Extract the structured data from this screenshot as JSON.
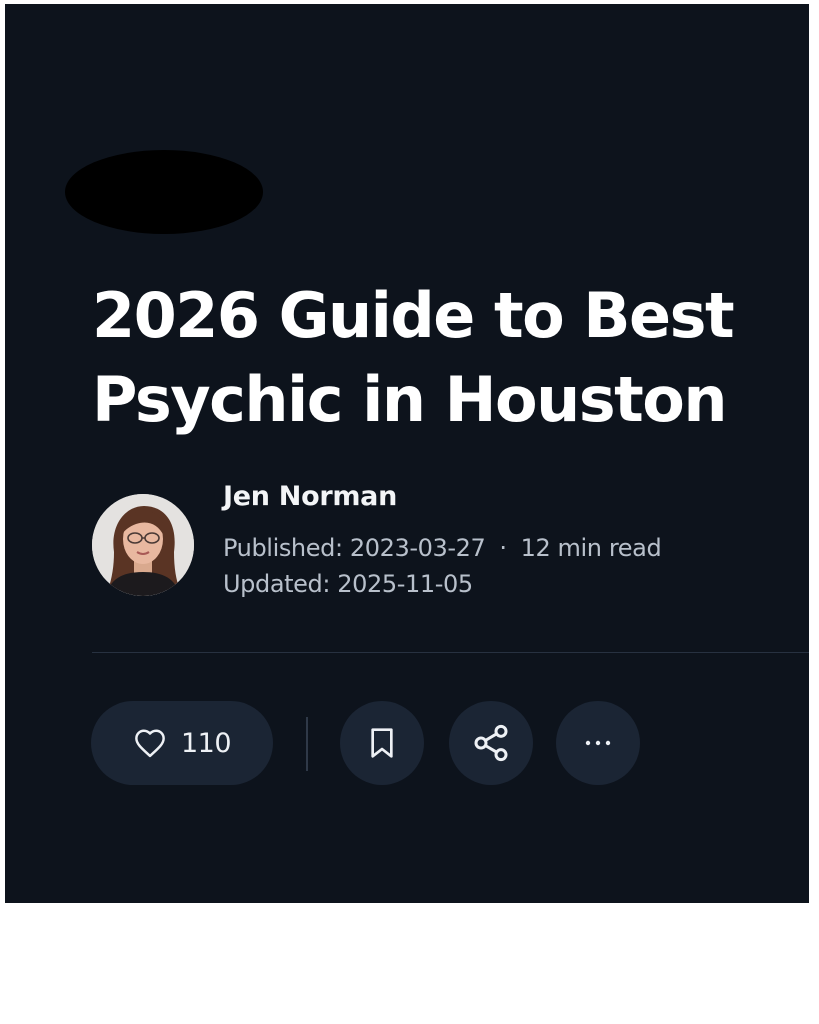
{
  "article": {
    "title": "2026 Guide to Best Psychic in Houston"
  },
  "author": {
    "name": "Jen Norman",
    "avatar_icon": "author-photo"
  },
  "meta": {
    "published": "Published: 2023-03-27",
    "separator": "·",
    "read_time": "12 min read",
    "updated": "Updated: 2025-11-05"
  },
  "actions": {
    "like_icon": "heart-icon",
    "like_count": "110",
    "bookmark_icon": "bookmark-icon",
    "share_icon": "share-icon",
    "more_icon": "more-dots-icon"
  },
  "colors": {
    "background": "#0d131c",
    "button": "#1b2534",
    "text": "#ffffff",
    "muted_text": "#b8c0cb"
  }
}
